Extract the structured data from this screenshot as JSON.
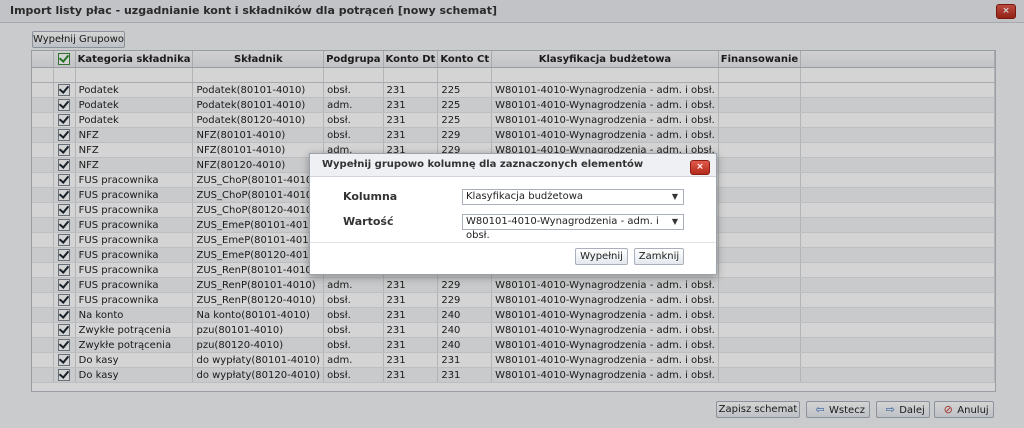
{
  "window": {
    "title": "Import listy płac - uzgadnianie kont i składników dla potrąceń [nowy schemat]"
  },
  "toolbar": {
    "fill_group_label": "Wypełnij Grupowo"
  },
  "grid": {
    "headers": [
      "",
      "Kategoria składnika",
      "Składnik",
      "Podgrupa",
      "Konto Dt",
      "Konto Ct",
      "Klasyfikacja budżetowa",
      "Finansowanie"
    ],
    "rows": [
      [
        "Podatek",
        "Podatek(80101-4010)",
        "obsł.",
        "231",
        "225",
        "W80101-4010-Wynagrodzenia - adm. i obsł."
      ],
      [
        "Podatek",
        "Podatek(80101-4010)",
        "adm.",
        "231",
        "225",
        "W80101-4010-Wynagrodzenia - adm. i obsł."
      ],
      [
        "Podatek",
        "Podatek(80120-4010)",
        "obsł.",
        "231",
        "225",
        "W80101-4010-Wynagrodzenia - adm. i obsł."
      ],
      [
        "NFZ",
        "NFZ(80101-4010)",
        "obsł.",
        "231",
        "229",
        "W80101-4010-Wynagrodzenia - adm. i obsł."
      ],
      [
        "NFZ",
        "NFZ(80101-4010)",
        "adm.",
        "231",
        "229",
        "W80101-4010-Wynagrodzenia - adm. i obsł."
      ],
      [
        "NFZ",
        "NFZ(80120-4010)",
        "",
        "",
        "",
        ""
      ],
      [
        "FUS pracownika",
        "ZUS_ChoP(80101-4010)",
        "",
        "",
        "",
        ""
      ],
      [
        "FUS pracownika",
        "ZUS_ChoP(80101-4010)",
        "",
        "",
        "",
        ""
      ],
      [
        "FUS pracownika",
        "ZUS_ChoP(80120-4010)",
        "",
        "",
        "",
        ""
      ],
      [
        "FUS pracownika",
        "ZUS_EmeP(80101-4010)",
        "",
        "",
        "",
        ""
      ],
      [
        "FUS pracownika",
        "ZUS_EmeP(80101-4010)",
        "",
        "",
        "",
        ""
      ],
      [
        "FUS pracownika",
        "ZUS_EmeP(80120-4010)",
        "",
        "",
        "",
        ""
      ],
      [
        "FUS pracownika",
        "ZUS_RenP(80101-4010)",
        "",
        "",
        "",
        ""
      ],
      [
        "FUS pracownika",
        "ZUS_RenP(80101-4010)",
        "adm.",
        "231",
        "229",
        "W80101-4010-Wynagrodzenia - adm. i obsł."
      ],
      [
        "FUS pracownika",
        "ZUS_RenP(80120-4010)",
        "obsł.",
        "231",
        "229",
        "W80101-4010-Wynagrodzenia - adm. i obsł."
      ],
      [
        "Na konto",
        "Na konto(80101-4010)",
        "obsł.",
        "231",
        "240",
        "W80101-4010-Wynagrodzenia - adm. i obsł."
      ],
      [
        "Zwykłe potrącenia",
        "pzu(80101-4010)",
        "obsł.",
        "231",
        "240",
        "W80101-4010-Wynagrodzenia - adm. i obsł."
      ],
      [
        "Zwykłe potrącenia",
        "pzu(80120-4010)",
        "obsł.",
        "231",
        "240",
        "W80101-4010-Wynagrodzenia - adm. i obsł."
      ],
      [
        "Do kasy",
        "do wypłaty(80101-4010)",
        "adm.",
        "231",
        "231",
        "W80101-4010-Wynagrodzenia - adm. i obsł."
      ],
      [
        "Do kasy",
        "do wypłaty(80120-4010)",
        "obsł.",
        "231",
        "231",
        "W80101-4010-Wynagrodzenia - adm. i obsł."
      ]
    ]
  },
  "dialog": {
    "title": "Wypełnij grupowo kolumnę dla zaznaczonych elementów",
    "column_label": "Kolumna",
    "column_value": "Klasyfikacja budżetowa",
    "value_label": "Wartość",
    "value_value": "W80101-4010-Wynagrodzenia - adm. i obsł.",
    "ok_label": "Wypełnij",
    "close_label": "Zamknij"
  },
  "footer": {
    "save_label": "Zapisz schemat",
    "back_label": "Wstecz",
    "next_label": "Dalej",
    "cancel_label": "Anuluj"
  },
  "icons": {
    "close": "close-icon",
    "back": "arrow-left-icon",
    "next": "arrow-right-icon",
    "cancel": "cancel-icon",
    "dropdown": "chevron-down-icon"
  }
}
